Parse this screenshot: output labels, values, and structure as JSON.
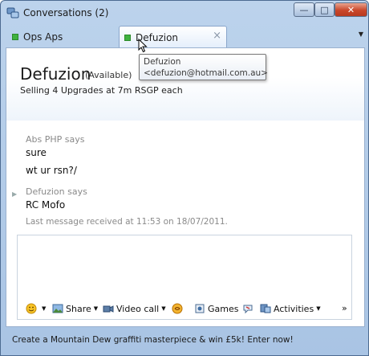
{
  "window": {
    "title": "Conversations (2)",
    "min_label": "—",
    "max_label": "□",
    "close_label": "✕"
  },
  "tabs": [
    {
      "label": "Ops Aps"
    },
    {
      "label": "Defuzion",
      "close": "×"
    }
  ],
  "tab_menu_glyph": "▼",
  "contact": {
    "name": "Defuzion",
    "status": "(Available)",
    "personal_message": "Selling 4 Upgrades at 7m RSGP each"
  },
  "tooltip": {
    "name": "Defuzion",
    "email": "<defuzion@hotmail.com.au>"
  },
  "conversation": [
    {
      "sender": "Abs PHP says",
      "lines": [
        "sure",
        "wt ur rsn?/"
      ]
    },
    {
      "sender": "Defuzion says",
      "lines": [
        "RC Mofo"
      ]
    }
  ],
  "last_message": "Last message received at 11:53 on 18/07/2011.",
  "toolbar": {
    "share": "Share",
    "video_call": "Video call",
    "games": "Games",
    "activities": "Activities",
    "more": "»"
  },
  "ad_text": "Create a Mountain Dew graffiti masterpiece & win £5k! Enter now!",
  "colors": {
    "status_green": "#3fb23f",
    "frame_blue": "#a9c4e4",
    "close_red": "#c9472a"
  }
}
